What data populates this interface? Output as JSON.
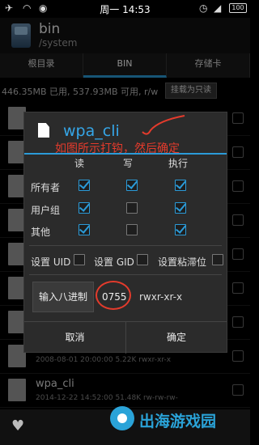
{
  "statusbar": {
    "time": "周一 14:53",
    "battery": "100"
  },
  "app": {
    "title": "bin",
    "path": "/system"
  },
  "tabs": [
    {
      "label": "根目录"
    },
    {
      "label": "BIN"
    },
    {
      "label": "存储卡"
    }
  ],
  "storage": {
    "text": "446.35MB 已用, 537.93MB 可用, r/w",
    "button": "挂载为只读"
  },
  "dialog": {
    "title": "wpa_cli",
    "annotation": "如图所示打钩，然后确定",
    "columns": {
      "read": "读",
      "write": "写",
      "exec": "执行"
    },
    "rows": [
      {
        "label": "所有者",
        "read": true,
        "write": true,
        "exec": true
      },
      {
        "label": "用户组",
        "read": true,
        "write": false,
        "exec": true
      },
      {
        "label": "其他",
        "read": true,
        "write": false,
        "exec": true
      }
    ],
    "options": {
      "uid": "设置 UID",
      "gid": "设置 GID",
      "sticky": "设置粘滞位"
    },
    "octal_button": "输入八进制",
    "octal_value": "0755",
    "perm_string": "rwxr-xr-x",
    "cancel": "取消",
    "ok": "确定"
  },
  "files": [
    {
      "meta": "2008-08-01 20:00:00  5.22K  rwxr-xr-x"
    },
    {
      "name": "wpa_cli",
      "meta": "2014-12-22 14:52:00  51.48K  rw-rw-rw-"
    }
  ],
  "watermark": {
    "text": "出海游戏园"
  }
}
